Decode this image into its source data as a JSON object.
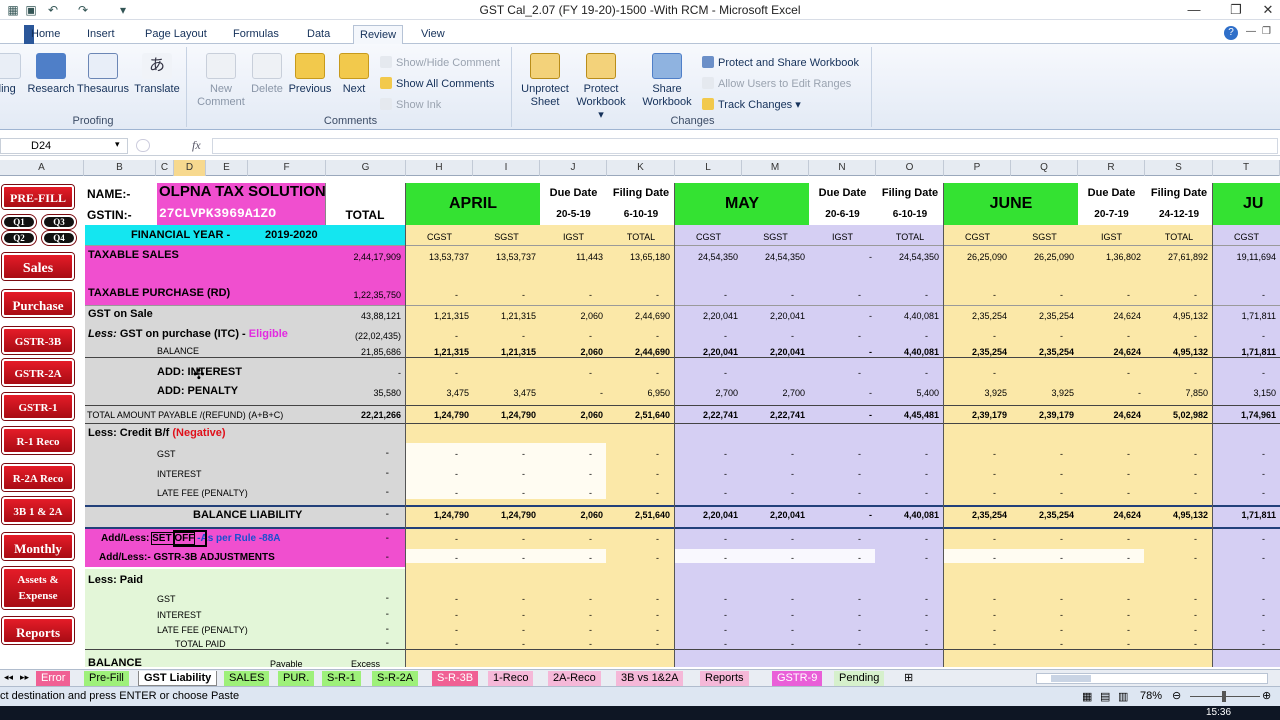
{
  "window": {
    "title": "GST Cal_2.07 (FY 19-20)-1500 -With RCM - Microsoft Excel"
  },
  "ribbon_tabs": [
    "Home",
    "Insert",
    "Page Layout",
    "Formulas",
    "Data",
    "Review",
    "View"
  ],
  "ribbon": {
    "proofing": {
      "label": "Proofing",
      "buttons": [
        "lling",
        "Research",
        "Thesaurus",
        "Translate"
      ]
    },
    "comments": {
      "label": "Comments",
      "new": "New",
      "new2": "Comment",
      "delete": "Delete",
      "previous": "Previous",
      "next": "Next",
      "show_hide": "Show/Hide Comment",
      "show_all": "Show All Comments",
      "show_ink": "Show Ink"
    },
    "changes": {
      "label": "Changes",
      "unprotect": "Unprotect",
      "unprotect2": "Sheet",
      "protect_wb": "Protect",
      "protect_wb2": "Workbook",
      "share": "Share",
      "share2": "Workbook",
      "protect_share": "Protect and Share Workbook",
      "allow_users": "Allow Users to Edit Ranges",
      "track": "Track Changes"
    }
  },
  "formula_bar": {
    "name_box": "D24",
    "fx": "fx",
    "formula": ""
  },
  "columns": [
    "A",
    "B",
    "C",
    "D",
    "E",
    "F",
    "G",
    "H",
    "I",
    "J",
    "K",
    "L",
    "M",
    "N",
    "O",
    "P",
    "Q",
    "R",
    "S",
    "T"
  ],
  "sidebar_buttons": [
    "PRE-FILL",
    "Q1",
    "Q3",
    "Q2",
    "Q4",
    "Sales",
    "Purchase",
    "GSTR-3B",
    "GSTR-2A",
    "GSTR-1",
    "R-1 Reco",
    "R-2A Reco",
    "3B 1 & 2A",
    "Monthly",
    "Assets &",
    "Expense",
    "Reports"
  ],
  "header": {
    "name_label": "NAME:-",
    "name_value": "OLPNA TAX SOLUTION",
    "gstin_label": "GSTIN:-",
    "gstin_value": "27CLVPK3969A1ZO",
    "total": "TOTAL",
    "fy_label": "FINANCIAL YEAR -",
    "fy_value": "2019-2020",
    "due_date": "Due Date",
    "filing_date": "Filing Date",
    "months": [
      {
        "name": "APRIL",
        "due": "20-5-19",
        "filing": "6-10-19"
      },
      {
        "name": "MAY",
        "due": "20-6-19",
        "filing": "6-10-19"
      },
      {
        "name": "JUNE",
        "due": "20-7-19",
        "filing": "24-12-19"
      },
      {
        "name": "JU"
      }
    ],
    "subheads": [
      "CGST",
      "SGST",
      "IGST",
      "TOTAL"
    ]
  },
  "rows": {
    "taxable_sales": {
      "label": "TAXABLE SALES",
      "total": "2,44,17,909",
      "vals": [
        "13,53,737",
        "13,53,737",
        "11,443",
        "13,65,180",
        "24,54,350",
        "24,54,350",
        "-",
        "24,54,350",
        "26,25,090",
        "26,25,090",
        "1,36,802",
        "27,61,892",
        "19,11,694"
      ]
    },
    "taxable_purchase": {
      "label": "TAXABLE PURCHASE (RD)",
      "total": "1,22,35,750"
    },
    "gst_on_sale": {
      "label": "GST on Sale",
      "total": "43,88,121",
      "vals": [
        "1,21,315",
        "1,21,315",
        "2,060",
        "2,44,690",
        "2,20,041",
        "2,20,041",
        "-",
        "4,40,081",
        "2,35,254",
        "2,35,254",
        "24,624",
        "4,95,132",
        "1,71,811"
      ]
    },
    "less_itc": {
      "label_a": "Less:",
      "label_b": "GST on purchase (ITC) -",
      "label_c": "Eligible",
      "total": "(22,02,435)"
    },
    "balance": {
      "label": "BALANCE",
      "total": "21,85,686",
      "vals": [
        "1,21,315",
        "1,21,315",
        "2,060",
        "2,44,690",
        "2,20,041",
        "2,20,041",
        "-",
        "4,40,081",
        "2,35,254",
        "2,35,254",
        "24,624",
        "4,95,132",
        "1,71,811"
      ]
    },
    "add_interest": {
      "label": "ADD: INTEREST",
      "total": "-"
    },
    "add_penalty": {
      "label": "ADD: PENALTY",
      "total": "35,580",
      "vals": [
        "3,475",
        "3,475",
        "-",
        "6,950",
        "2,700",
        "2,700",
        "-",
        "5,400",
        "3,925",
        "3,925",
        "-",
        "7,850",
        "3,150"
      ]
    },
    "total_payable": {
      "label": "TOTAL AMOUNT PAYABLE /(REFUND) (A+B+C)",
      "total": "22,21,266",
      "vals": [
        "1,24,790",
        "1,24,790",
        "2,060",
        "2,51,640",
        "2,22,741",
        "2,22,741",
        "-",
        "4,45,481",
        "2,39,179",
        "2,39,179",
        "24,624",
        "5,02,982",
        "1,74,961"
      ]
    },
    "credit_bf": {
      "label_a": "Less: Credit B/f",
      "label_b": "(Negative)",
      "gst": "GST",
      "interest": "INTEREST",
      "late_fee": "LATE FEE (PENALTY)"
    },
    "balance_liability": {
      "label": "BALANCE LIABILITY",
      "vals": [
        "1,24,790",
        "1,24,790",
        "2,060",
        "2,51,640",
        "2,20,041",
        "2,20,041",
        "-",
        "4,40,081",
        "2,35,254",
        "2,35,254",
        "24,624",
        "4,95,132",
        "1,71,811"
      ]
    },
    "set_off": {
      "label_a": "Add/Less:",
      "label_b": "SET OFF",
      "label_c": "-As per Rule -88A"
    },
    "adjustments": {
      "label": "Add/Less:- GSTR-3B  ADJUSTMENTS"
    },
    "less_paid": {
      "label": "Less: Paid",
      "gst": "GST",
      "interest": "INTEREST",
      "late_fee": "LATE FEE (PENALTY)",
      "total_paid": "TOTAL PAID"
    },
    "balance_bottom": {
      "label": "BALANCE",
      "payable": "Payable",
      "excess": "Excess"
    },
    "dash": "-"
  },
  "sheet_tabs": [
    "Error",
    "Pre-Fill",
    "GST Liability",
    "SALES",
    "PUR.",
    "S-R-1",
    "S-R-2A",
    "S-R-3B",
    "1-Reco",
    "2A-Reco",
    "3B vs 1&2A",
    "Reports",
    "GSTR-9",
    "Pending"
  ],
  "status": {
    "text": "ct destination and press ENTER or choose Paste",
    "zoom": "78%"
  },
  "taskbar": {
    "time": "15:36"
  },
  "colors": {
    "pink": "#f04fcf",
    "green": "#34e232",
    "yellow": "#fbe8a8",
    "lavender": "#d5cff3",
    "cyan": "#14e6f0",
    "red_button": "#d0121c",
    "excel_blue": "#2b579a"
  }
}
